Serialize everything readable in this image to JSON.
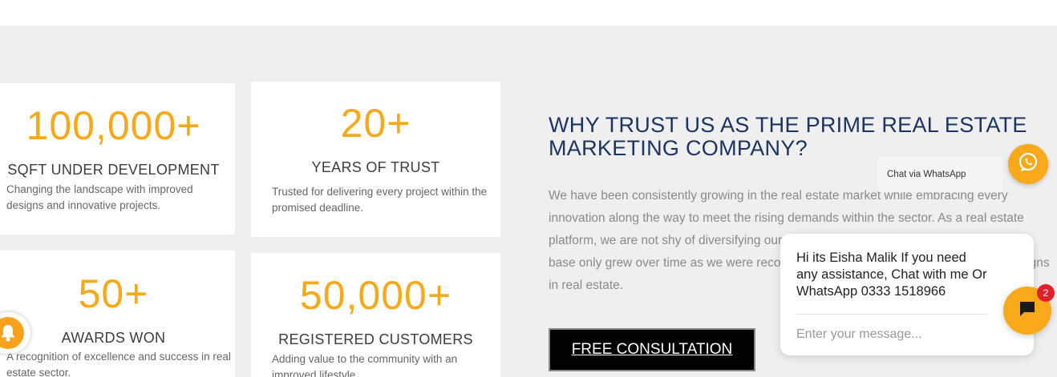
{
  "stats": [
    {
      "number": "100,000+",
      "title": "SQFT UNDER DEVELOPMENT",
      "description": "Changing the landscape with improved designs and innovative projects."
    },
    {
      "number": "20+",
      "title": "YEARS OF TRUST",
      "description": "Trusted for delivering every project within the promised deadline."
    },
    {
      "number": "50+",
      "title": "AWARDS WON",
      "description": "A recognition of excellence and success in real estate sector."
    },
    {
      "number": "50,000+",
      "title": "REGISTERED CUSTOMERS",
      "description": "Adding value to the community with an improved lifestyle."
    }
  ],
  "main": {
    "heading": "WHY TRUST US AS THE PRIME REAL ESTATE MARKETING COMPANY?",
    "paragraph": "We have been consistently growing in the real estate market while embracing every innovation along the way to meet the rising demands within the sector. As a real estate platform, we are not shy of diversifying our projects and working with clients. Our client base only grew over time as we were recognized for running the best marketing campaigns in real estate.",
    "cta_label": "FREE CONSULTATION"
  },
  "whatsapp": {
    "label": "Chat via WhatsApp",
    "icon": "whatsapp-icon"
  },
  "chat": {
    "message": "Hi its Eisha Malik If you need any assistance, Chat with me Or WhatsApp 0333 1518966",
    "input_placeholder": "Enter your message...",
    "badge_count": "2",
    "icon": "chat-bubble-icon"
  },
  "notification": {
    "icon": "bell-icon"
  },
  "colors": {
    "accent": "#f7a91a",
    "heading": "#1b3464",
    "background": "#efefef",
    "badge": "#e0212c"
  }
}
